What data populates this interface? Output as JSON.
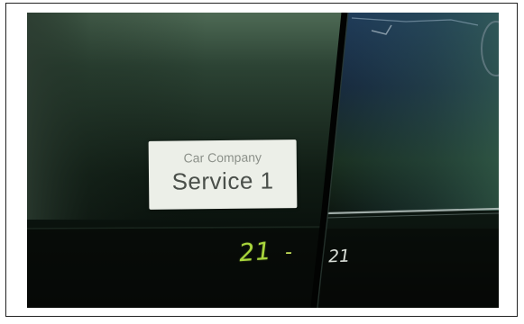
{
  "photo": {
    "label": {
      "company": "Car Company",
      "service": "Service 1"
    },
    "handwriting": {
      "left_mark": "21",
      "dash": "-",
      "right_mark": "21"
    }
  },
  "colors": {
    "body_paint": "#0e1a13",
    "label_background": "#ecefe8",
    "marker_green": "#a9d63c",
    "marker_white": "#d8ddd6"
  }
}
